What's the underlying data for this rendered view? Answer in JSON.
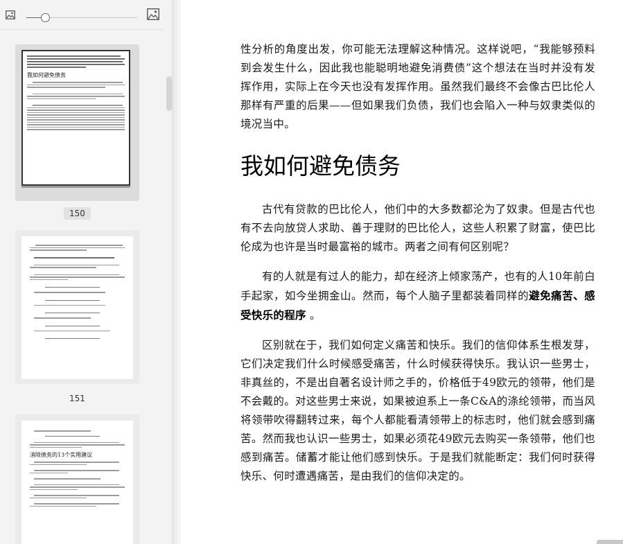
{
  "toolbar": {
    "left_icon": "image-small-icon",
    "right_icon": "image-large-icon",
    "zoom_fraction": 0.17
  },
  "thumbnails": [
    {
      "page": "150",
      "selected": true,
      "heading": "我如何避免债务"
    },
    {
      "page": "151",
      "selected": false
    },
    {
      "page": "",
      "selected": false,
      "heading": "消除债务的13个实用建议"
    }
  ],
  "document": {
    "para_top": "性分析的角度出发，你可能无法理解这种情况。这样说吧，“我能够预料到会发生什么，因此我也能聪明地避免消费债”这个想法在当时并没有发挥作用，实际上在今天也没有发挥作用。虽然我们最终不会像古巴比伦人那样有严重的后果——但如果我们负债，我们也会陷入一种与奴隶类似的境况当中。",
    "heading": "我如何避免债务",
    "para1": "古代有贷款的巴比伦人，他们中的大多数都沦为了奴隶。但是古代也有不去向放贷人求助、善于理财的巴比伦人，这些人积累了财富，使巴比伦成为也许是当时最富裕的城市。两者之间有何区别呢？",
    "para2_normal": "有的人就是有过人的能力，却在经济上倾家荡产，也有的人10年前白手起家，如今坐拥金山。然而，每个人脑子里都装着同样的",
    "para2_bold": "避免痛苦、感受快乐的程序",
    "para2_end": " 。",
    "para3": "区别就在于，我们如何定义痛苦和快乐。我们的信仰体系生根发芽，它们决定我们什么时候感受痛苦，什么时候获得快乐。我认识一些男士，非真丝的，不是出自著名设计师之手的，价格低于49欧元的领带，他们是不会戴的。对这些男士来说，如果被迫系上一条C&A的涤纶领带，而当风将领带吹得翻转过来，每个人都能看清领带上的标志时，他们就会感到痛苦。然而我也认识一些男士，如果必须花49欧元去购买一条领带，他们也感到痛苦。储蓄才能让他们感到快乐。于是我们就能断定：我们何时获得快乐、何时遭遇痛苦，是由我们的信仰决定的。"
  }
}
